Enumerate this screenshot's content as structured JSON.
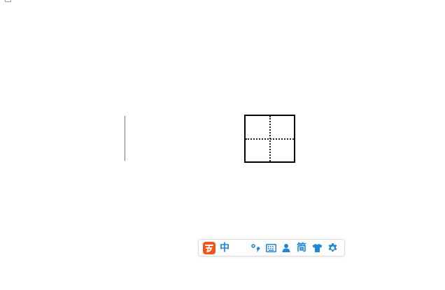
{
  "colors": {
    "accent": "#1f86d8",
    "logo_bg": "#f2541b",
    "logo_fg": "#ffffff"
  },
  "ime_toolbar": {
    "logo": {
      "icon": "ime-logo-icon"
    },
    "mode_label": "中",
    "punctuation": {
      "icon": "half-moon-icon"
    },
    "symbols": {
      "icon": "dot-comma-icon"
    },
    "keyboard": {
      "icon": "keyboard-icon"
    },
    "account": {
      "icon": "user-icon"
    },
    "charset_label": "简",
    "skin": {
      "icon": "tshirt-icon"
    },
    "settings": {
      "icon": "gear-icon"
    }
  },
  "editor": {
    "caret": {
      "icon": "text-caret"
    },
    "grid": {
      "type": "tianzige"
    }
  }
}
